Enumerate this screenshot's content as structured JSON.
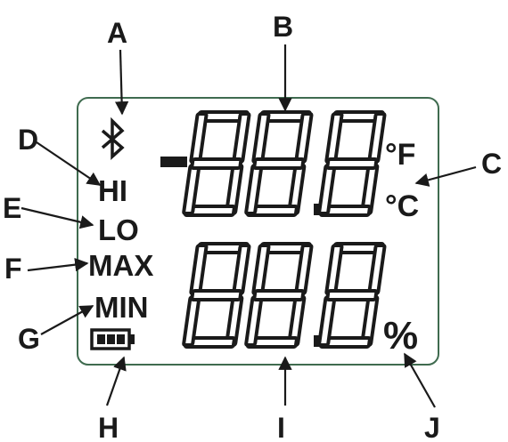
{
  "callouts": {
    "A": "A",
    "B": "B",
    "C": "C",
    "D": "D",
    "E": "E",
    "F": "F",
    "G": "G",
    "H": "H",
    "I": "I",
    "J": "J"
  },
  "display": {
    "minus_sign": "-",
    "top_digits": "88.8",
    "bottom_digits": "88.8",
    "fahrenheit": "°F",
    "celsius": "°C",
    "percent": "%",
    "indicators": {
      "hi": "HI",
      "lo": "LO",
      "max": "MAX",
      "min": "MIN"
    },
    "icons": [
      "bluetooth-icon",
      "battery-icon"
    ]
  },
  "colors": {
    "lcd_border": "#3f6b4f",
    "ink": "#1a1a1a"
  }
}
